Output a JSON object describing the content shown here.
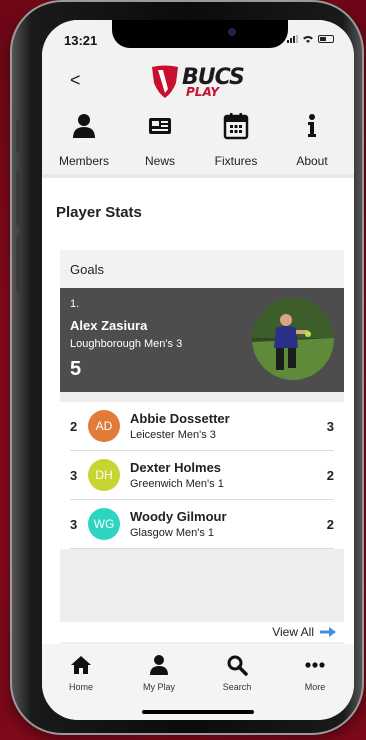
{
  "status": {
    "time": "13:21"
  },
  "header": {
    "back_label": "<",
    "logo_main": "BUCS",
    "logo_sub": "PLAY"
  },
  "nav_tabs": [
    {
      "label": "Members",
      "icon": "person-icon"
    },
    {
      "label": "News",
      "icon": "newspaper-icon"
    },
    {
      "label": "Fixtures",
      "icon": "calendar-icon"
    },
    {
      "label": "About",
      "icon": "info-icon"
    }
  ],
  "page": {
    "title": "Player Stats"
  },
  "goals_card": {
    "title": "Goals",
    "leader": {
      "rank": "1.",
      "name": "Alex Zasiura",
      "team": "Loughborough Men's 3",
      "goals": "5"
    },
    "rows": [
      {
        "rank": "2",
        "initials": "AD",
        "name": "Abbie Dossetter",
        "team": "Leicester Men's 3",
        "goals": "3",
        "color": "#e07b39"
      },
      {
        "rank": "3",
        "initials": "DH",
        "name": "Dexter Holmes",
        "team": "Greenwich Men's 1",
        "goals": "2",
        "color": "#c7d431"
      },
      {
        "rank": "3",
        "initials": "WG",
        "name": "Woody Gilmour",
        "team": "Glasgow Men's 1",
        "goals": "2",
        "color": "#2ed4c2"
      }
    ],
    "view_all_label": "View All"
  },
  "tabbar": [
    {
      "label": "Home",
      "icon": "home-icon"
    },
    {
      "label": "My Play",
      "icon": "person-icon"
    },
    {
      "label": "Search",
      "icon": "search-icon"
    },
    {
      "label": "More",
      "icon": "more-icon"
    }
  ],
  "colors": {
    "brand_red": "#c8102e",
    "leader_bg": "#4d4d4d",
    "link_blue": "#3f8fd8"
  }
}
